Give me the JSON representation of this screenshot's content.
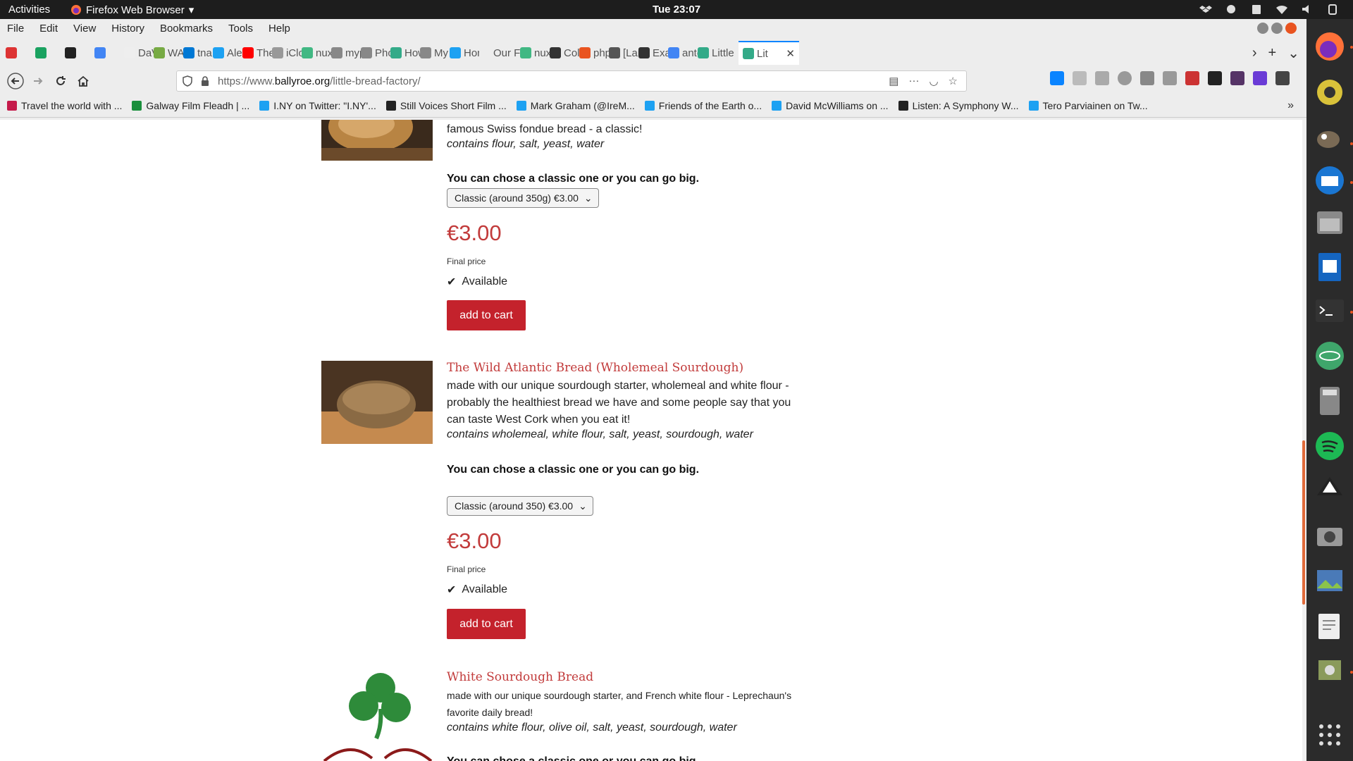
{
  "topbar": {
    "activities": "Activities",
    "app_name": "Firefox Web Browser",
    "clock": "Tue 23:07"
  },
  "menubar": {
    "items": [
      "File",
      "Edit",
      "View",
      "History",
      "Bookmarks",
      "Tools",
      "Help"
    ]
  },
  "tabs": [
    {
      "label": "",
      "color": "#d33"
    },
    {
      "label": "",
      "color": "#1aa260"
    },
    {
      "label": "",
      "color": "#222"
    },
    {
      "label": "",
      "color": "#4285f4"
    },
    {
      "label": "DaVi",
      "color": "#eee"
    },
    {
      "label": "WAW",
      "color": "#7a4"
    },
    {
      "label": "tna",
      "color": "#0078d4"
    },
    {
      "label": "Alex",
      "color": "#1da1f2"
    },
    {
      "label": "The",
      "color": "#f00"
    },
    {
      "label": "iClou",
      "color": "#999"
    },
    {
      "label": "nuxt",
      "color": "#41b883"
    },
    {
      "label": "mypl",
      "color": "#888"
    },
    {
      "label": "Phot",
      "color": "#888"
    },
    {
      "label": "How",
      "color": "#3a8"
    },
    {
      "label": "My a",
      "color": "#888"
    },
    {
      "label": "Hom",
      "color": "#1da1f2"
    },
    {
      "label": "Our Fina",
      "color": "#ededed"
    },
    {
      "label": "nuxt",
      "color": "#41b883"
    },
    {
      "label": "Colla",
      "color": "#333"
    },
    {
      "label": "php",
      "color": "#e95420"
    },
    {
      "label": "[Lara",
      "color": "#555"
    },
    {
      "label": "Exam",
      "color": "#333"
    },
    {
      "label": "anto",
      "color": "#4285f4"
    },
    {
      "label": "Little",
      "color": "#3a8"
    },
    {
      "label": "Lit",
      "color": "#3a8"
    }
  ],
  "url": {
    "prefix": "https://www.",
    "domain": "ballyroe.org",
    "path": "/little-bread-factory/"
  },
  "bookmarks": [
    {
      "label": "Travel the world with ...",
      "color": "#c51a4a"
    },
    {
      "label": "Galway Film Fleadh | ...",
      "color": "#1a8f3c"
    },
    {
      "label": "I.NY on Twitter: \"I.NY'...",
      "color": "#1da1f2"
    },
    {
      "label": "Still Voices Short Film ...",
      "color": "#222"
    },
    {
      "label": "Mark Graham (@IreM...",
      "color": "#1da1f2"
    },
    {
      "label": "Friends of the Earth o...",
      "color": "#1da1f2"
    },
    {
      "label": "David McWilliams on ...",
      "color": "#1da1f2"
    },
    {
      "label": "Listen: A Symphony W...",
      "color": "#222"
    },
    {
      "label": "Tero Parviainen on Tw...",
      "color": "#1da1f2"
    }
  ],
  "products": [
    {
      "title": "",
      "description": "famous Swiss fondue bread - a classic!",
      "contains": "contains flour, salt, yeast, water",
      "choose": "You can chose a classic one or you can go big.",
      "option": "Classic (around 350g) €3.00",
      "price": "€3.00",
      "final": "Final price",
      "availability": "Available",
      "cart": "add to cart"
    },
    {
      "title": "The Wild Atlantic Bread (Wholemeal Sourdough)",
      "description": "made with our unique sourdough starter, wholemeal and white flour - probably the healthiest bread we have and some people say that you can taste West Cork when you eat it!",
      "contains": "contains wholemeal, white flour, salt, yeast, sourdough, water",
      "choose": "You can chose a classic one or you can go big.",
      "option": "Classic (around 350) €3.00",
      "price": "€3.00",
      "final": "Final price",
      "availability": "Available",
      "cart": "add to cart"
    },
    {
      "title": "White Sourdough Bread",
      "description": "made with our unique sourdough starter,  and French white flour - Leprechaun's favorite daily bread!",
      "contains": "contains white flour, olive oil, salt, yeast, sourdough, water",
      "choose": "You can chose a classic one or you can go big."
    }
  ],
  "colors": {
    "accent": "#c4222c",
    "title_red": "#c23b3b",
    "shamrock": "#2e8b3a"
  }
}
